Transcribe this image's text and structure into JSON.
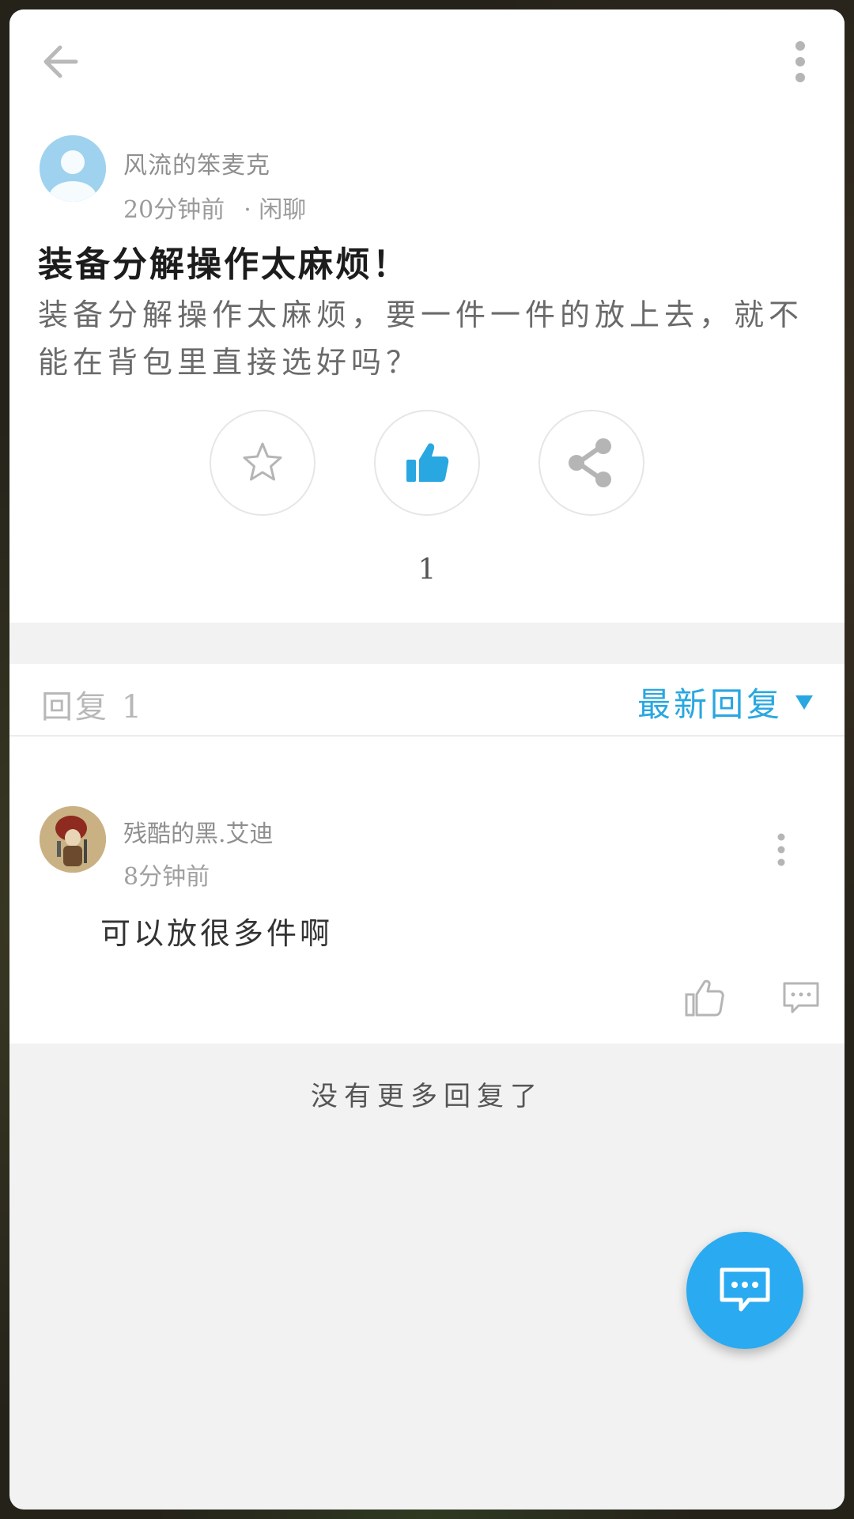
{
  "topbar": {
    "back_icon": "arrow-left-icon",
    "more_icon": "more-vertical-icon"
  },
  "post": {
    "author_name": "风流的笨麦克",
    "time": "20分钟前",
    "category": "· 闲聊",
    "title": "装备分解操作太麻烦！",
    "body": "装备分解操作太麻烦，要一件一件的放上去，就不能在背包里直接选好吗？",
    "like_count": "1",
    "actions": {
      "favorite_icon": "star-icon",
      "like_icon": "thumbs-up-icon",
      "share_icon": "share-icon"
    }
  },
  "replies_header": {
    "count_label": "回复 1",
    "sort_label": "最新回复"
  },
  "replies": [
    {
      "author_name": "残酷的黑.艾迪",
      "time": "8分钟前",
      "text": "可以放很多件啊"
    }
  ],
  "footer": {
    "no_more": "没有更多回复了"
  },
  "colors": {
    "accent": "#29a7e1",
    "fab": "#2aaaf0",
    "title": "#1c1c1c",
    "muted": "#9b9b9b"
  }
}
